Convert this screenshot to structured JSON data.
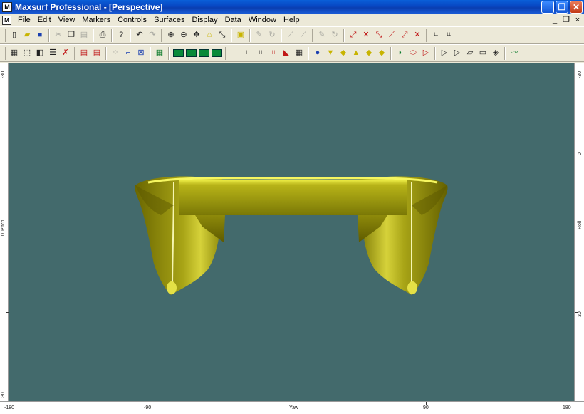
{
  "window": {
    "title": "Maxsurf Professional - [Perspective]",
    "app_icon_glyph": "M",
    "minimize_glyph": "_",
    "maximize_glyph": "❐",
    "close_glyph": "✕"
  },
  "menubar": {
    "items": [
      "File",
      "Edit",
      "View",
      "Markers",
      "Controls",
      "Surfaces",
      "Display",
      "Data",
      "Window",
      "Help"
    ],
    "mdi_minimize": "_",
    "mdi_restore": "❐",
    "mdi_close": "×"
  },
  "rulers": {
    "left_labels": [
      "-30",
      "0",
      "Pitch",
      "30"
    ],
    "right_labels": [
      "-30",
      "0",
      "Roll",
      "30"
    ],
    "bottom_labels": [
      "-180",
      "-90",
      "Yaw",
      "90",
      "180"
    ]
  },
  "toolbar1_icons": [
    "new-file-icon",
    "open-file-icon",
    "save-icon",
    "cut-icon",
    "copy-icon",
    "paste-icon",
    "print-icon",
    "help-icon",
    "undo-icon",
    "redo-icon",
    "zoom-in-icon",
    "zoom-out-icon",
    "pan-icon",
    "home-view-icon",
    "shrink-icon",
    "select-surface-icon",
    "pen-icon",
    "rotate-icon",
    "wand-icon",
    "wand2-icon",
    "brush-icon",
    "rotate2-icon",
    "marker-add-icon",
    "marker-delete-icon",
    "control-point-icon",
    "move-point-icon",
    "curve-icon",
    "delete-point-icon",
    "measure-icon",
    "measure2-icon"
  ],
  "toolbar2_icons": [
    "surface-box-icon",
    "trim-icon",
    "shade-icon",
    "surface-list-icon",
    "delete-surface-icon",
    "layers-icon",
    "layers2-icon",
    "grid-dots-icon",
    "curve-edit-icon",
    "grid-x-icon",
    "table-icon",
    "view-body-icon",
    "view-plan-icon",
    "view-profile-icon",
    "view-persp-icon",
    "net-icon",
    "markers-icon",
    "contours-icon",
    "stations-icon",
    "graph-icon",
    "spreadsheet-icon",
    "render-icon",
    "light1-icon",
    "light2-icon",
    "light3-icon",
    "light4-icon",
    "light5-icon",
    "hull-icon",
    "hull2-icon",
    "hull3-icon",
    "shape1-icon",
    "shape2-icon",
    "shape3-icon",
    "shape4-icon",
    "shape5-icon",
    "curve-tool-icon"
  ],
  "colors": {
    "viewport_bg": "#436a6c",
    "hull_base": "#8c8c0c",
    "hull_highlight": "#e6e640",
    "hull_shadow": "#4c4c00"
  }
}
